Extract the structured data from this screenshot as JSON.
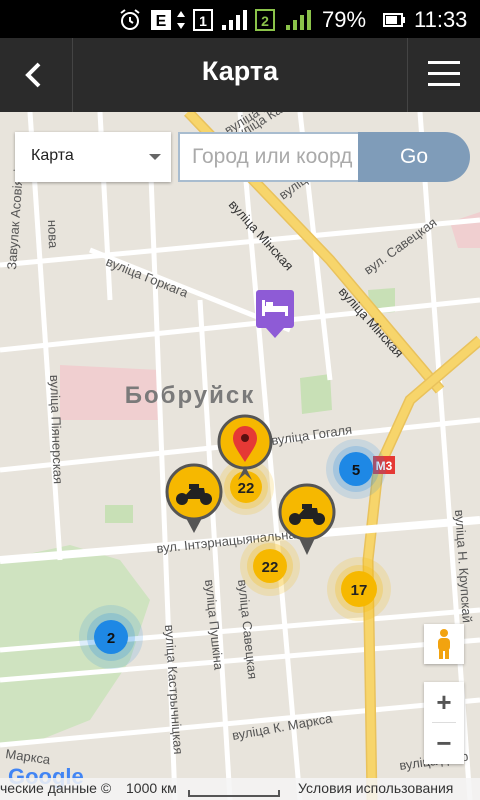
{
  "status_bar": {
    "battery": "79%",
    "time": "11:33",
    "sim1": "1",
    "sim2": "2",
    "e_label": "E"
  },
  "app_bar": {
    "title": "Карта"
  },
  "controls": {
    "map_type": "Карта",
    "search_placeholder": "Город или коорд",
    "go_label": "Go"
  },
  "map": {
    "city_label": "Бобруйск",
    "streets": [
      "вуліца Мінская",
      "вуліца Мінская",
      "вуліца Кастрычніцкая",
      "вуліца Пушкіна",
      "вул. Савецкая",
      "вуліца Горкага",
      "вуліца Піянерская",
      "вул. Інтэрнацыянальная",
      "вуліца Савецкая",
      "вуліца Пушкіна",
      "вуліца Кастрычніцкая",
      "вуліца К. Маркса",
      "вуліца Н. Крупскай",
      "Завулак Асовіяхіма",
      "вуліца Гогаля",
      "Маркса",
      "вуліца дзяр",
      "нова",
      "вуліца Кастры"
    ],
    "road_shield": "М3",
    "clusters": [
      {
        "count": "22",
        "color": "yellow"
      },
      {
        "count": "22",
        "color": "yellow"
      },
      {
        "count": "17",
        "color": "yellow"
      },
      {
        "count": "5",
        "color": "blue"
      },
      {
        "count": "2",
        "color": "blue"
      }
    ],
    "markers": [
      "motorcycle",
      "motorcycle",
      "location-pin",
      "hotel"
    ],
    "zoom_in": "+",
    "zoom_out": "−"
  },
  "footer": {
    "map_data": "ческие данные ©",
    "scale": "1000 км",
    "terms": "Условия использования",
    "logo": "Google"
  },
  "colors": {
    "appbar": "#2b2b2b",
    "go_button": "#7f9cb9",
    "cluster_yellow": "#f6b800",
    "cluster_blue": "#1e88e5",
    "pin_red": "#e53935",
    "hotel_purple": "#8e5bd6",
    "road_yellow": "#f7d56b"
  }
}
